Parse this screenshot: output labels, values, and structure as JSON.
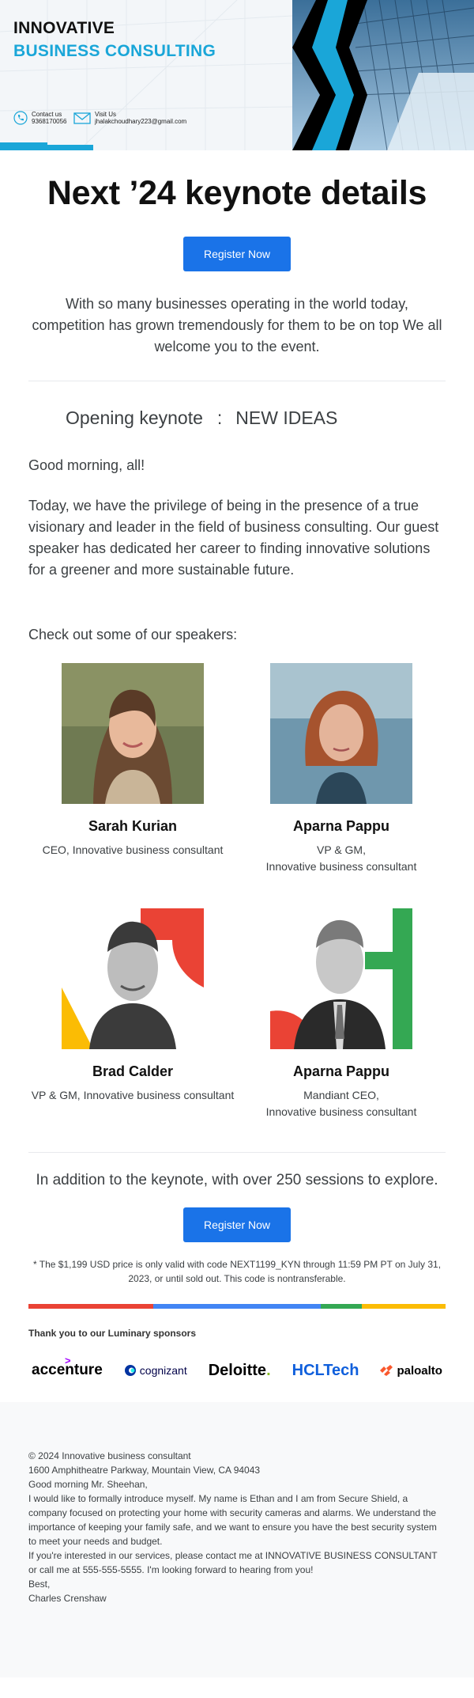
{
  "banner": {
    "brand_line1": "INNOVATIVE",
    "brand_line2": "BUSINESS CONSULTING",
    "contact_label": "Contact us",
    "contact_phone": "9368170056",
    "visit_label": "Visit Us",
    "visit_email": "jhalakchoudhary223@gmail.com"
  },
  "headline": "Next ’24 keynote details",
  "register_label": "Register Now",
  "intro": "With so many businesses operating in the world today, competition has grown tremendously for them to be on top We all welcome you to the event.",
  "keynote": {
    "left": "Opening keynote",
    "separator": ":",
    "right": "NEW IDEAS"
  },
  "greeting": "Good morning, all!",
  "body_text": "Today, we have the privilege of being in the presence of a true visionary and leader in the field of business consulting. Our guest speaker has dedicated her career to finding innovative solutions for a greener and more sustainable future.",
  "speakers_title": "Check out some of our speakers:",
  "speakers": [
    {
      "name": "Sarah Kurian",
      "role": "CEO, Innovative business consultant"
    },
    {
      "name": "Aparna Pappu",
      "role": "VP & GM,\nInnovative business consultant"
    },
    {
      "name": "Brad Calder",
      "role": "VP & GM, Innovative business consultant"
    },
    {
      "name": "Aparna Pappu",
      "role": "Mandiant CEO,\nInnovative business consultant"
    }
  ],
  "addition": "In addition to the keynote,  with over 250 sessions to explore.",
  "fine_print": "* The $1,199 USD price is only valid with code NEXT1199_KYN through 11:59 PM PT on July 31, 2023, or until sold out. This code is nontransferable.",
  "colors": {
    "accent": "#1a73e8",
    "brand_blue": "#1aa6d8",
    "red": "#ea4335",
    "blue": "#4285f4",
    "green": "#34a853",
    "yellow": "#fbbc04"
  },
  "sponsors_title": "Thank you to our Luminary sponsors",
  "sponsors": {
    "accenture": "accenture",
    "cognizant": "cognizant",
    "deloitte": "Deloitte",
    "deloitte_dot": ".",
    "hcl": "HCLTech",
    "palo": "paloalto"
  },
  "footer": {
    "copyright": "© 2024 Innovative business consultant",
    "address": "1600 Amphitheatre Parkway, Mountain View, CA 94043",
    "salutation": "Good morning Mr. Sheehan,",
    "paragraph1": "I would like to formally introduce myself. My name is Ethan and I am from Secure Shield, a company focused on protecting your home with security cameras and alarms. We understand the importance of keeping your family safe, and we want to ensure you have the best security system to meet your needs and budget.",
    "paragraph2": "If you're interested in our services, please contact me at INNOVATIVE BUSINESS CONSULTANT or call me at 555-555-5555. I'm looking forward to hearing from you!",
    "closing": "Best,",
    "signature": "Charles Crenshaw"
  }
}
